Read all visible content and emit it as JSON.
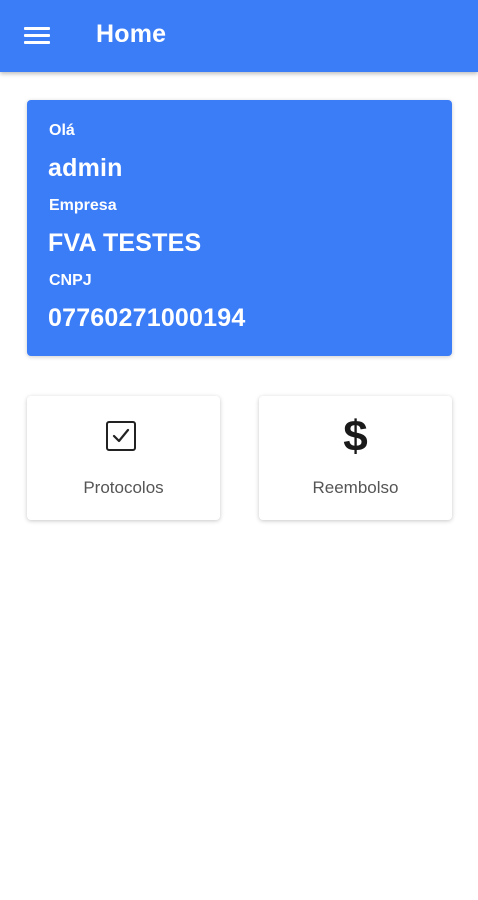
{
  "header": {
    "title": "Home",
    "menu_icon": "menu-icon"
  },
  "user_card": {
    "greeting_label": "Olá",
    "username": "admin",
    "company_label": "Empresa",
    "company_name": "FVA TESTES",
    "cnpj_label": "CNPJ",
    "cnpj_value": "07760271000194"
  },
  "tiles": [
    {
      "label": "Protocolos",
      "icon": "checkbox-icon"
    },
    {
      "label": "Reembolso",
      "icon": "dollar-icon",
      "glyph": "$"
    }
  ],
  "colors": {
    "primary": "#3b7cf7",
    "tile_text": "#555555",
    "icon": "#222222"
  }
}
